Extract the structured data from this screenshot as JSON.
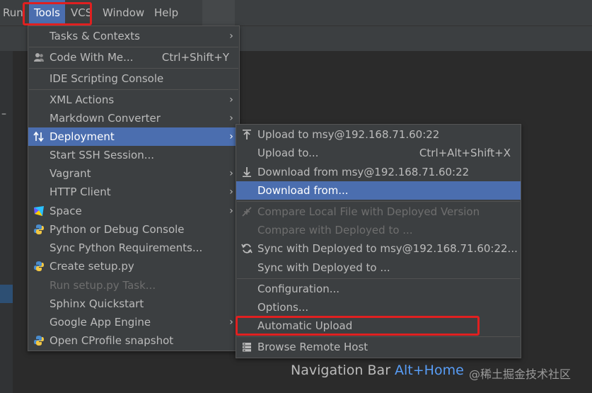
{
  "menubar": {
    "items": [
      {
        "label": "Run"
      },
      {
        "label": "Tools"
      },
      {
        "label": "VCS"
      },
      {
        "label": "Window"
      },
      {
        "label": "Help"
      }
    ]
  },
  "tools_menu": {
    "items": [
      {
        "label": "Tasks & Contexts",
        "submenu": true
      },
      {
        "label": "Code With Me...",
        "shortcut": "Ctrl+Shift+Y",
        "icon": "people-icon"
      },
      {
        "label": "IDE Scripting Console"
      },
      {
        "label": "XML Actions",
        "submenu": true
      },
      {
        "label": "Markdown Converter",
        "submenu": true
      },
      {
        "label": "Deployment",
        "submenu": true,
        "selected": true,
        "icon": "deploy-arrows-icon"
      },
      {
        "label": "Start SSH Session..."
      },
      {
        "label": "Vagrant",
        "submenu": true
      },
      {
        "label": "HTTP Client",
        "submenu": true
      },
      {
        "label": "Space",
        "submenu": true,
        "icon": "space-icon"
      },
      {
        "label": "Python or Debug Console",
        "icon": "python-icon"
      },
      {
        "label": "Sync Python Requirements..."
      },
      {
        "label": "Create setup.py",
        "icon": "python-icon"
      },
      {
        "label": "Run setup.py Task...",
        "disabled": true
      },
      {
        "label": "Sphinx Quickstart"
      },
      {
        "label": "Google App Engine",
        "submenu": true
      },
      {
        "label": "Open CProfile snapshot",
        "icon": "python-icon"
      }
    ]
  },
  "deployment_menu": {
    "items": [
      {
        "label": "Upload to msy@192.168.71.60:22",
        "icon": "upload-icon"
      },
      {
        "label": "Upload to...",
        "shortcut": "Ctrl+Alt+Shift+X"
      },
      {
        "label": "Download from msy@192.168.71.60:22",
        "icon": "download-icon"
      },
      {
        "label": "Download from...",
        "selected": true
      },
      {
        "label": "Compare Local File with Deployed Version",
        "disabled": true,
        "icon": "compare-icon"
      },
      {
        "label": "Compare with Deployed to ...",
        "disabled": true
      },
      {
        "label": "Sync with Deployed to msy@192.168.71.60:22...",
        "icon": "sync-icon"
      },
      {
        "label": "Sync with Deployed to ..."
      },
      {
        "label": "Configuration..."
      },
      {
        "label": "Options..."
      },
      {
        "label": "Automatic Upload"
      },
      {
        "label": "Browse Remote Host",
        "icon": "server-icon"
      }
    ]
  },
  "hint": {
    "text": "Navigation Bar",
    "shortcut": "Alt+Home"
  },
  "watermark": "@稀土掘金技术社区",
  "colors": {
    "accent": "#4b6eaf",
    "highlight": "#e02020",
    "hint_shortcut": "#589df6"
  }
}
